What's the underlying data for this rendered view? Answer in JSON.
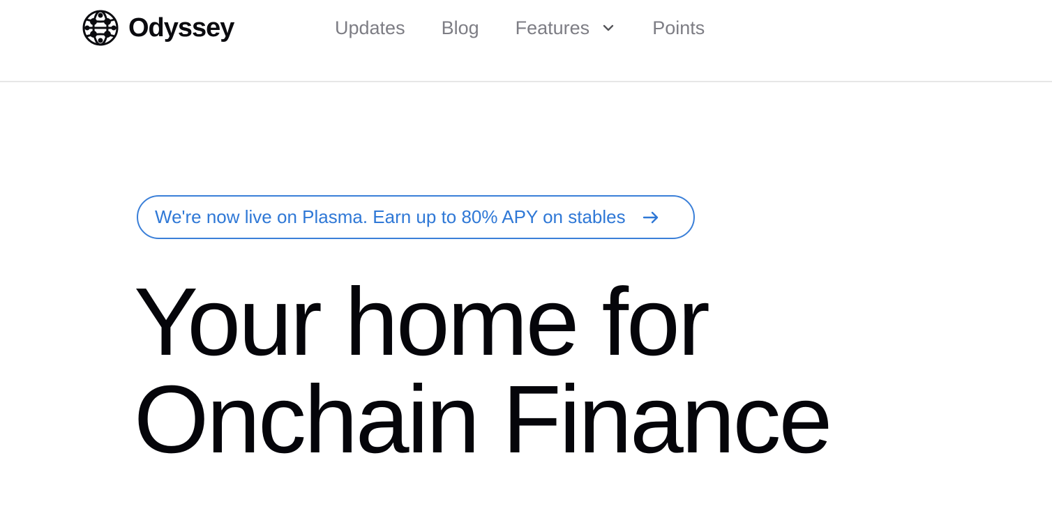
{
  "brand": {
    "name": "Odyssey",
    "logo_icon": "globe-grid-icon"
  },
  "nav": {
    "items": [
      {
        "label": "Updates"
      },
      {
        "label": "Blog"
      },
      {
        "label": "Features",
        "icon": "chevron-down-icon"
      },
      {
        "label": "Points"
      }
    ]
  },
  "announcement": {
    "text": "We're now live on Plasma. Earn up to 80% APY on stables",
    "icon": "arrow-right-icon",
    "color": "#2f78d6"
  },
  "hero": {
    "line1": "Your home for",
    "line2": "Onchain Finance"
  },
  "colors": {
    "text": "#05050a",
    "nav_text": "#7d7d84",
    "accent": "#3a7fd8",
    "divider": "#e6e6e6"
  }
}
